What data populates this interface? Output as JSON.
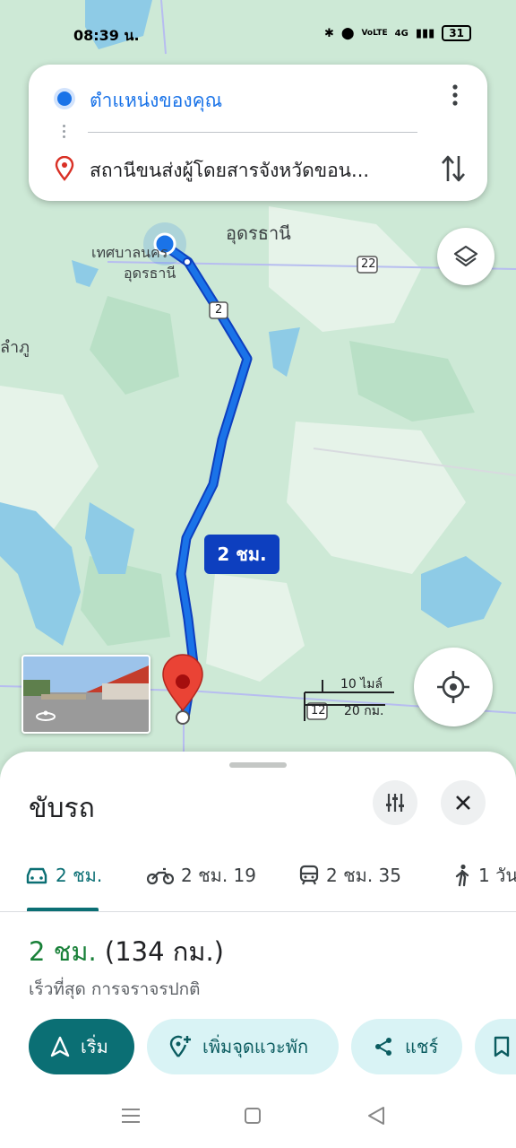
{
  "status_bar": {
    "time": "08:39 น.",
    "net": "VoLTE",
    "net2": "4G",
    "battery": "31"
  },
  "search": {
    "origin": "ตำแหน่งของคุณ",
    "destination": "สถานีขนส่งผู้โดยสารจังหวัดขอน..."
  },
  "map": {
    "city_label": "อุดรธานี",
    "municipality_label_1": "เทศบาลนคร",
    "municipality_label_2": "อุดรธานี",
    "left_label": "ลำภู",
    "route_time_badge": "2 ชม.",
    "highway_22": "22",
    "highway_2": "2",
    "highway_12": "12",
    "scale_miles": "10 ไมล์",
    "scale_km": "20 กม.",
    "route_color": "#1a73e8",
    "land_color": "#cde9d6",
    "water_color": "#8ecbe6"
  },
  "sheet": {
    "title": "ขับรถ",
    "modes": [
      {
        "icon": "car-icon",
        "label": "2 ชม."
      },
      {
        "icon": "motorcycle-icon",
        "label": "2 ชม. 19"
      },
      {
        "icon": "transit-icon",
        "label": "2 ชม. 35"
      },
      {
        "icon": "walk-icon",
        "label": "1 วัน"
      }
    ],
    "duration": "2 ชม.",
    "distance": "(134 กม.)",
    "subtitle": "เร็วที่สุด การจราจรปกติ",
    "actions": {
      "start": "เริ่ม",
      "add_stop": "เพิ่มจุดแวะพัก",
      "share": "แชร์"
    },
    "accent_color": "#0b6f74"
  }
}
